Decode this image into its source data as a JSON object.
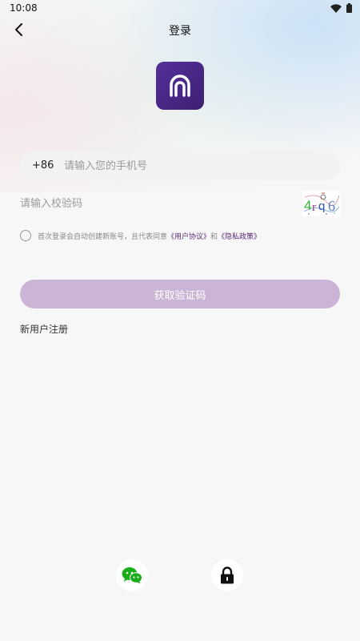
{
  "status_bar": {
    "time": "10:08"
  },
  "header": {
    "title": "登录"
  },
  "phone": {
    "country_code": "+86",
    "placeholder": "请输入您的手机号"
  },
  "captcha": {
    "placeholder": "请输入校验码",
    "code": "4rq6"
  },
  "agreement": {
    "prefix": "首次登录会自动创建新账号，且代表同意",
    "user_agreement": "《用户协议》",
    "and": "和",
    "privacy_policy": "《隐私政策》"
  },
  "actions": {
    "get_code_label": "获取验证码",
    "register_label": "新用户注册"
  },
  "colors": {
    "brand": "#4a2887",
    "button_disabled": "#cbb5d6",
    "wechat": "#1aad19",
    "link": "#5a2a73"
  },
  "icons": {
    "back": "chevron-left-icon",
    "wechat": "wechat-icon",
    "lock": "lock-icon"
  }
}
